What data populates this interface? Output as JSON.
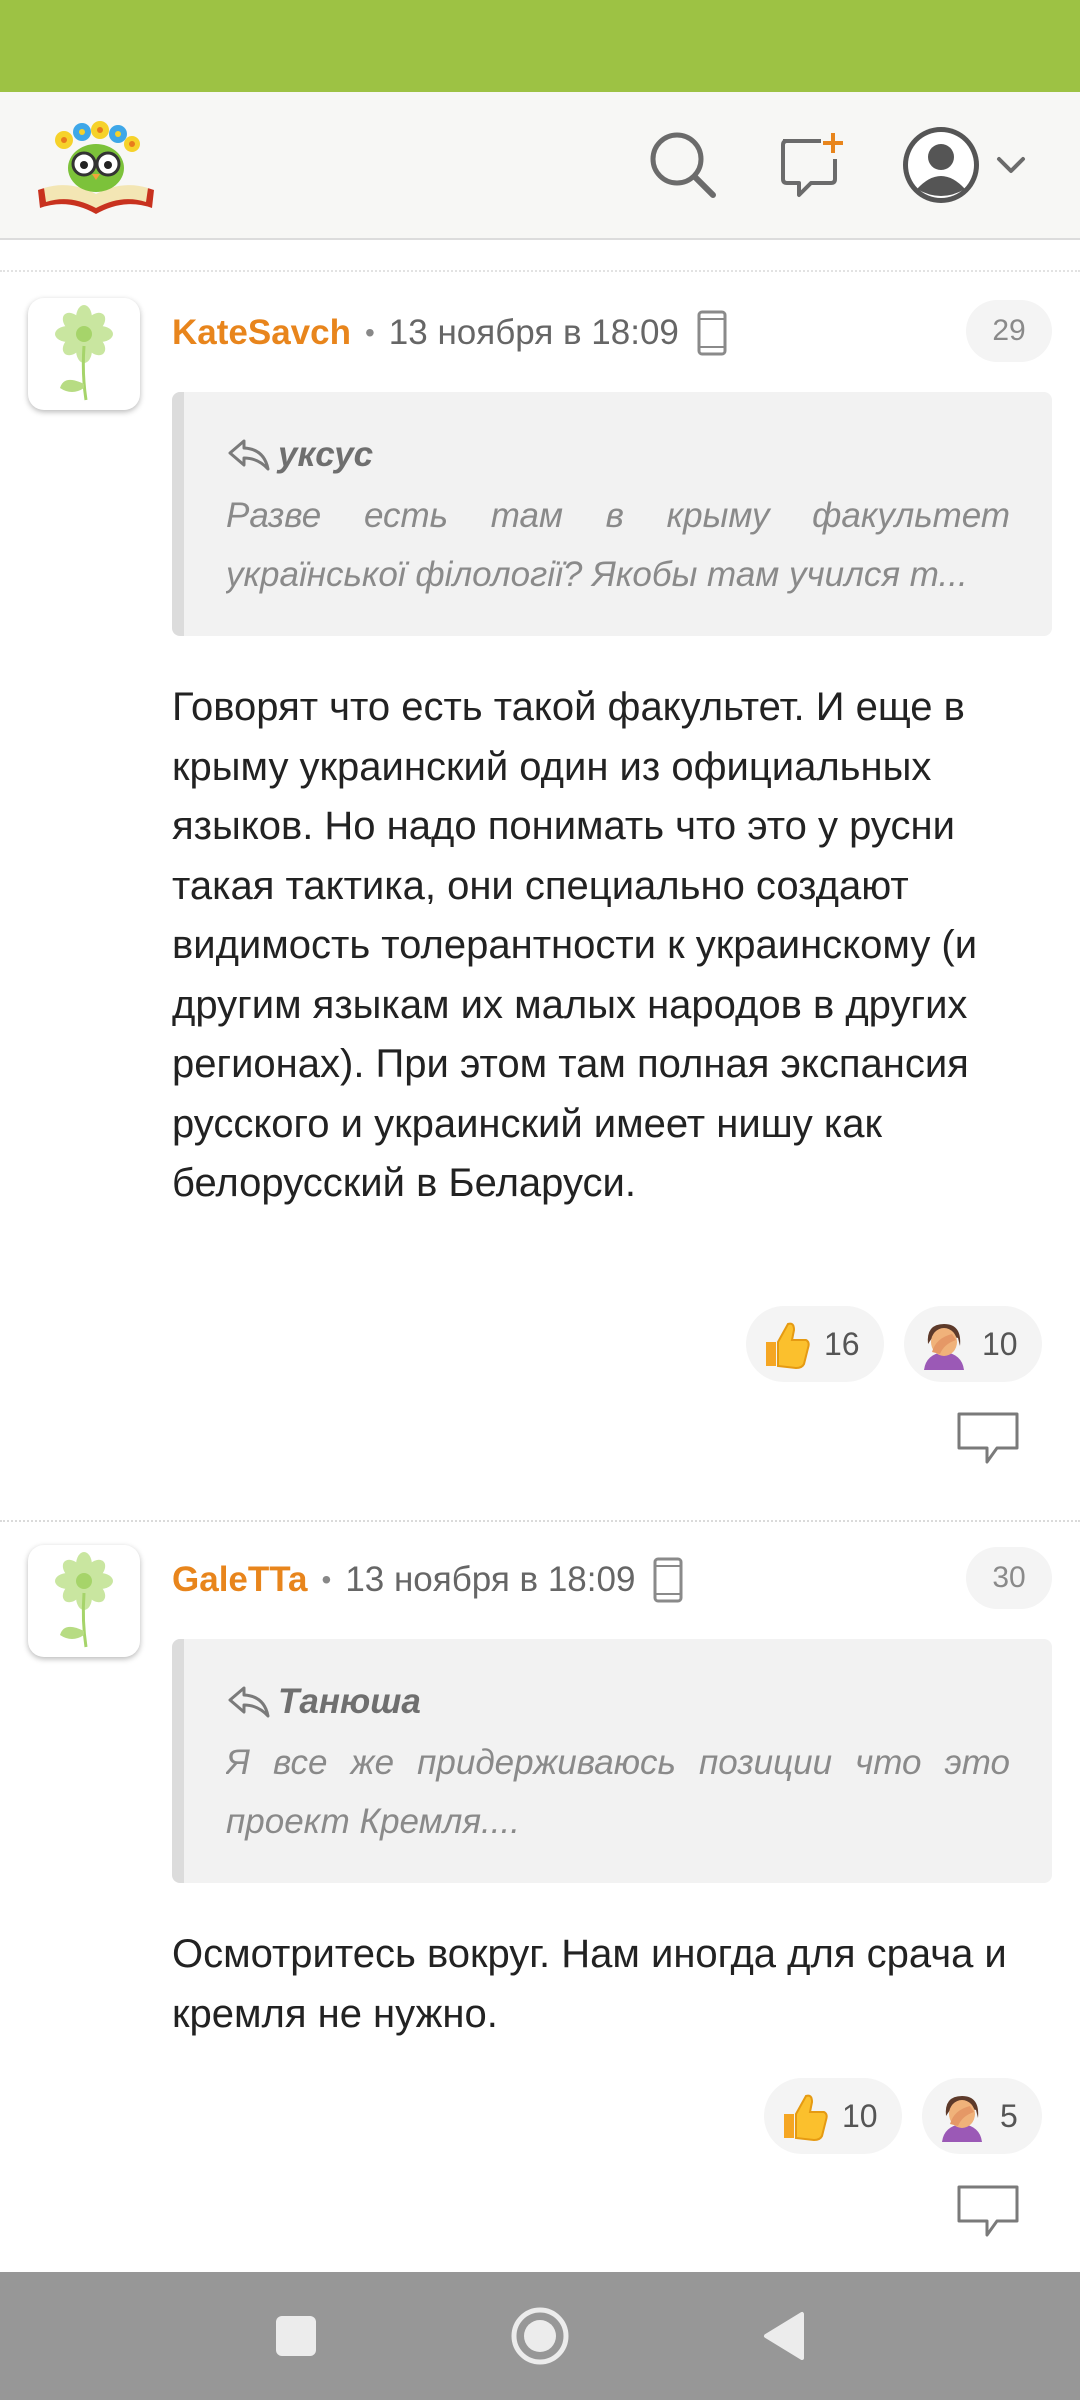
{
  "colors": {
    "status_bar": "#9dc244",
    "author": "#e8851c",
    "nav_bar": "#979797"
  },
  "header": {
    "logo_icon": "owl-book-logo",
    "search_icon": "search-icon",
    "new_post_icon": "new-post-icon",
    "profile_icon": "user-avatar-icon",
    "menu_icon": "chevron-down-icon"
  },
  "comments": [
    {
      "author": "KateSavch",
      "date": "13 ноября в 18:09",
      "device_icon": "phone-icon",
      "number": "29",
      "quote": {
        "author": "уксус",
        "text": "Разве есть там в крыму факультет української філології? Якобы там учился т..."
      },
      "text": "Говорят что есть такой факультет. И еще в крыму украинский один из официальных языков. Но надо понимать что это у русни такая тактика, они специально создают видимость толерантности к украинскому (и другим языкам их малых народов в других регионах). При этом там полная экспансия русского и украинский имеет нишу как белорусский в Беларуси.",
      "reactions": [
        {
          "icon": "thumbs-up-icon",
          "count": "16"
        },
        {
          "icon": "facepalm-icon",
          "count": "10"
        }
      ]
    },
    {
      "author": "GaleTTa",
      "date": "13 ноября в 18:09",
      "device_icon": "phone-icon",
      "number": "30",
      "quote": {
        "author": "Танюша",
        "text": "Я все же придерживаюсь позиции что это проект Кремля...."
      },
      "text": "Осмотритесь вокруг. Нам иногда для срача и кремля не нужно.",
      "reactions": [
        {
          "icon": "thumbs-up-icon",
          "count": "10"
        },
        {
          "icon": "facepalm-icon",
          "count": "5"
        }
      ]
    }
  ],
  "nav": {
    "recents_icon": "square-icon",
    "home_icon": "circle-icon",
    "back_icon": "triangle-back-icon"
  }
}
